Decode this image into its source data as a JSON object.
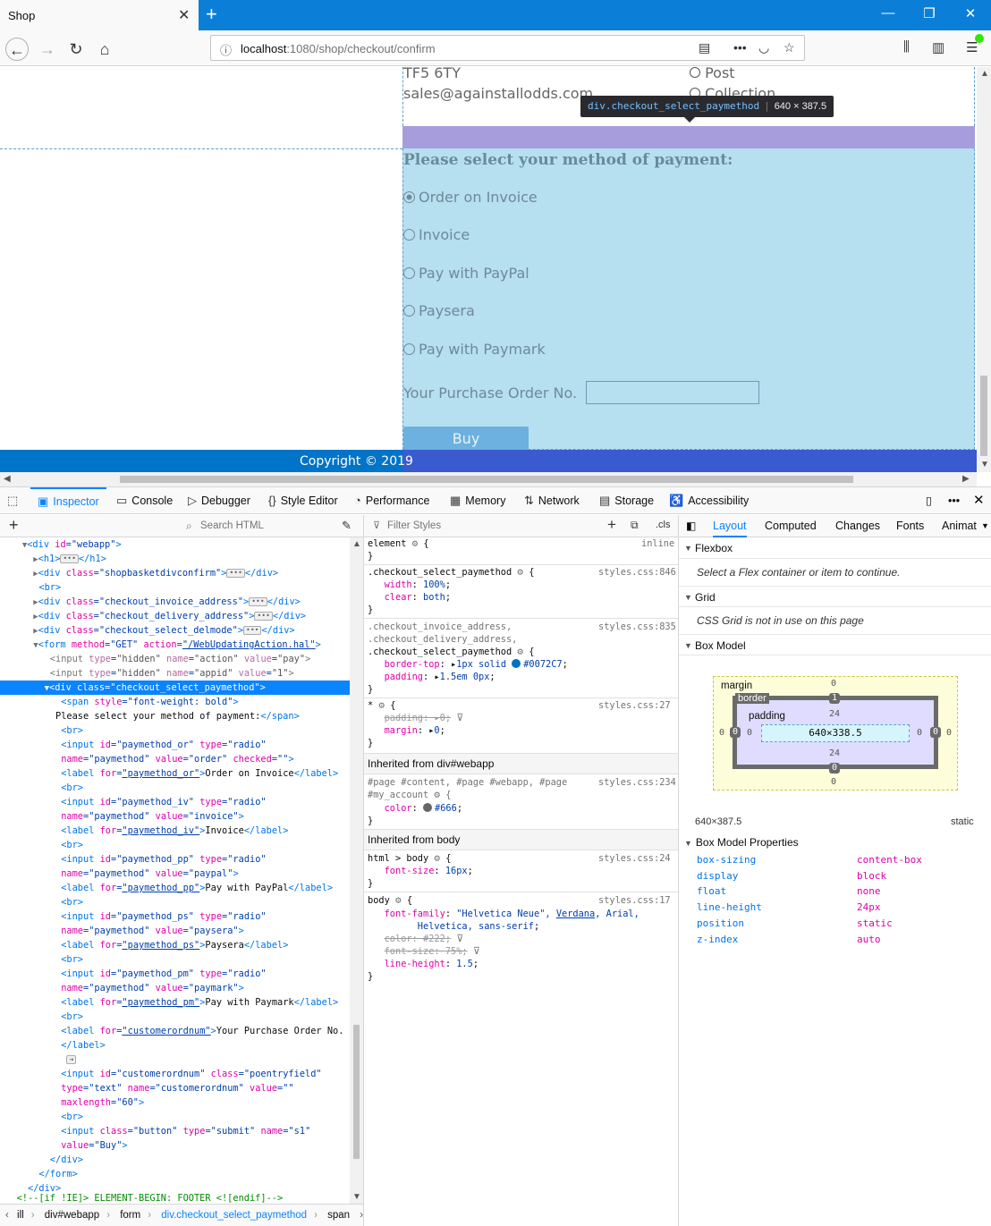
{
  "browser": {
    "tab_title": "Shop",
    "url_host": "localhost",
    "url_path": ":1080/shop/checkout/confirm"
  },
  "page": {
    "address_line1": "TF5 6TY",
    "address_line2": "sales@againstallodds.com",
    "delmode_option1": "Post",
    "delmode_option2": "Collection",
    "pay_heading": "Please select your method of payment:",
    "pay_options": [
      {
        "label": "Order on Invoice",
        "checked": true
      },
      {
        "label": "Invoice",
        "checked": false
      },
      {
        "label": "Pay with PayPal",
        "checked": false
      },
      {
        "label": "Paysera",
        "checked": false
      },
      {
        "label": "Pay with Paymark",
        "checked": false
      }
    ],
    "po_label": "Your Purchase Order No.",
    "po_value": "",
    "buy_label": "Buy",
    "footer": "Copyright © 2019"
  },
  "tooltip": {
    "tag": "div",
    "cls": ".checkout_select_paymethod",
    "dims": "640 × 387.5"
  },
  "devtools": {
    "tabs": [
      "Inspector",
      "Console",
      "Debugger",
      "Style Editor",
      "Performance",
      "Memory",
      "Network",
      "Storage",
      "Accessibility"
    ],
    "search_placeholder": "Search HTML",
    "filter_placeholder": "Filter Styles",
    "cls_label": ".cls",
    "breadcrumbs": [
      "ill",
      "div#webapp",
      "form",
      "div.checkout_select_paymethod",
      "span"
    ],
    "layout_tabs": [
      "Layout",
      "Computed",
      "Changes",
      "Fonts",
      "Animat"
    ],
    "flexbox_title": "Flexbox",
    "flexbox_msg": "Select a Flex container or item to continue.",
    "grid_title": "Grid",
    "grid_msg": "CSS Grid is not in use on this page",
    "boxmodel_title": "Box Model",
    "boxmodel": {
      "margin_label": "margin",
      "border_label": "border",
      "padding_label": "padding",
      "content": "640×338.5",
      "margin_top": "0",
      "margin_bottom": "0",
      "margin_left": "0",
      "margin_right": "0",
      "border_top": "1",
      "border_bottom": "0",
      "border_left": "0",
      "border_right": "0",
      "padding_top": "24",
      "padding_bottom": "24",
      "padding_left": "0",
      "padding_right": "0",
      "size": "640×387.5",
      "position": "static"
    },
    "boxmodel_props_title": "Box Model Properties",
    "boxmodel_props": [
      {
        "k": "box-sizing",
        "v": "content-box"
      },
      {
        "k": "display",
        "v": "block"
      },
      {
        "k": "float",
        "v": "none"
      },
      {
        "k": "line-height",
        "v": "24px"
      },
      {
        "k": "position",
        "v": "static"
      },
      {
        "k": "z-index",
        "v": "auto"
      }
    ],
    "inherited_webapp": "Inherited from div#webapp",
    "inherited_body": "Inherited from body"
  },
  "colors": {
    "accent": "#0a84ff",
    "border_top_color": "#0072C7",
    "text_color": "#666"
  }
}
